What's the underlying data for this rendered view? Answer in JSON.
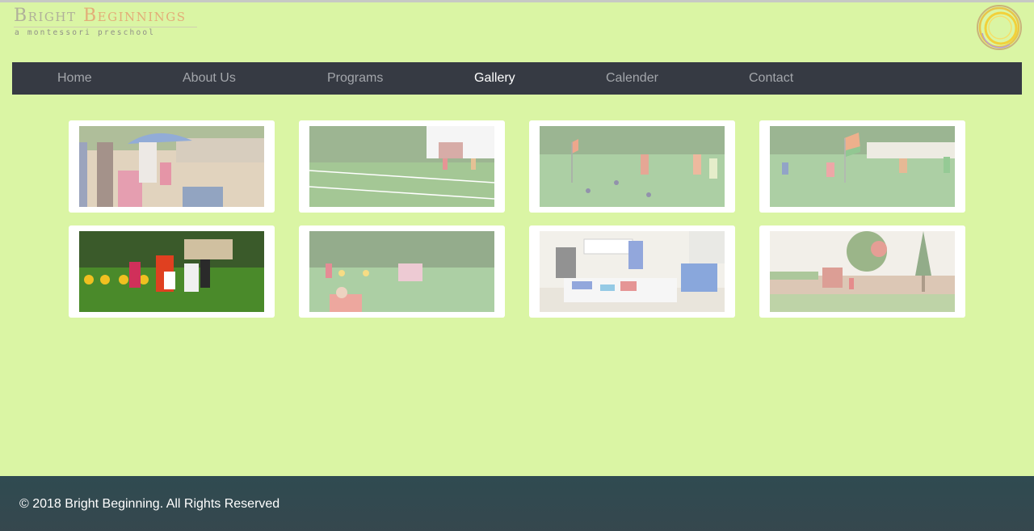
{
  "header": {
    "logo_word1": "Bright",
    "logo_word2": "Beginnings",
    "tagline": "a montessori preschool"
  },
  "nav": {
    "items": [
      {
        "label": "Home",
        "active": false
      },
      {
        "label": "About Us",
        "active": false
      },
      {
        "label": "Programs",
        "active": false
      },
      {
        "label": "Gallery",
        "active": true
      },
      {
        "label": "Calender",
        "active": false
      },
      {
        "label": "Contact",
        "active": false
      }
    ]
  },
  "gallery": {
    "photos": [
      {
        "subject": "children with umbrella in play yard"
      },
      {
        "subject": "sports track on field near building"
      },
      {
        "subject": "flag and children on field"
      },
      {
        "subject": "children running on field with flag"
      },
      {
        "subject": "children in costumes on lawn"
      },
      {
        "subject": "children playing on lawn"
      },
      {
        "subject": "children working on floor activity"
      },
      {
        "subject": "garden with trees and playhouse"
      }
    ]
  },
  "footer": {
    "copyright": "© 2018 Bright Beginning. All Rights Reserved"
  },
  "colors": {
    "page_background": "#daf5a4",
    "nav_background": "#363a43",
    "footer_background": "#2f4b51",
    "nav_active": "#ffffff",
    "nav_inactive": "#a3a6ab",
    "logo_word1": "#b0b09a",
    "logo_word2": "#e3ad78"
  }
}
